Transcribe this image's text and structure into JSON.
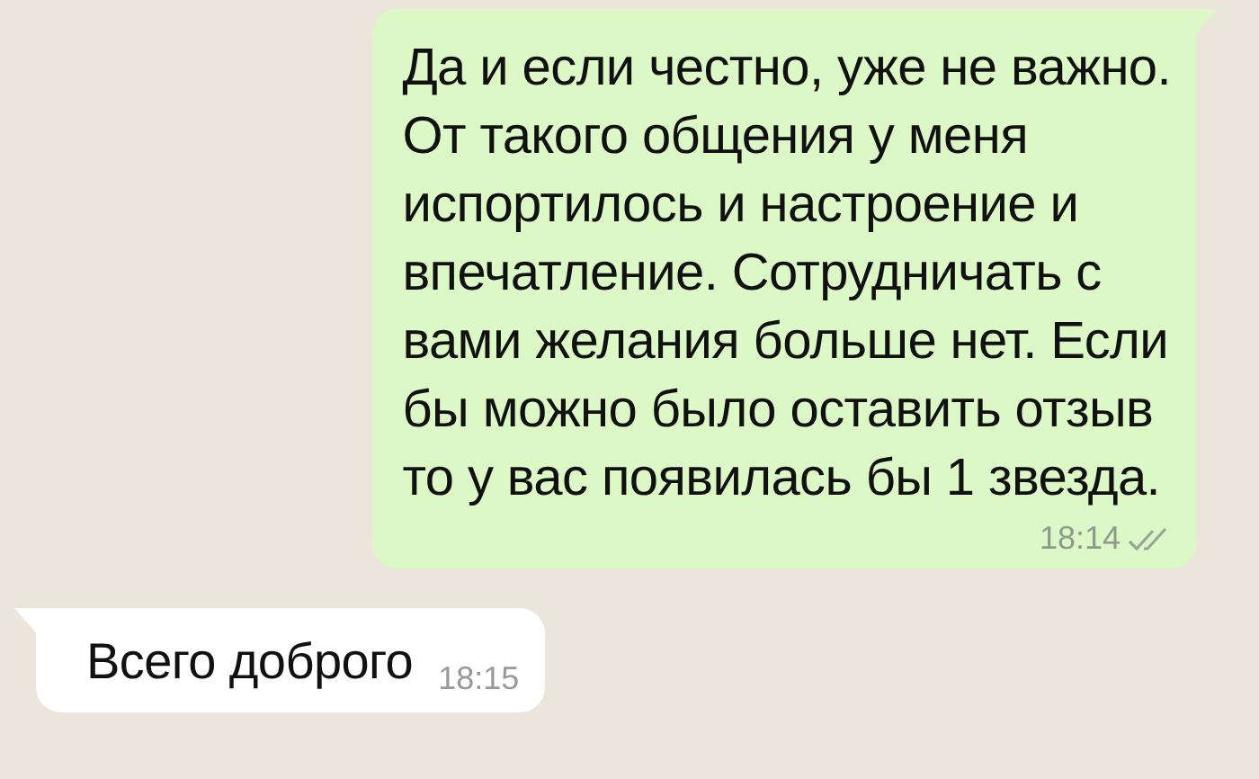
{
  "messages": [
    {
      "kind": "outgoing",
      "text": "Да и если честно, уже не важно.\nОт такого общения у меня\nиспортилось и настроение и\nвпечатление. Сотрудничать с\nвами желания больше нет. Если\nбы можно было оставить отзыв\nто у вас появилась бы 1 звезда.",
      "time": "18:14",
      "read": false
    },
    {
      "kind": "incoming",
      "text": "Всего доброго",
      "time": "18:15"
    }
  ]
}
